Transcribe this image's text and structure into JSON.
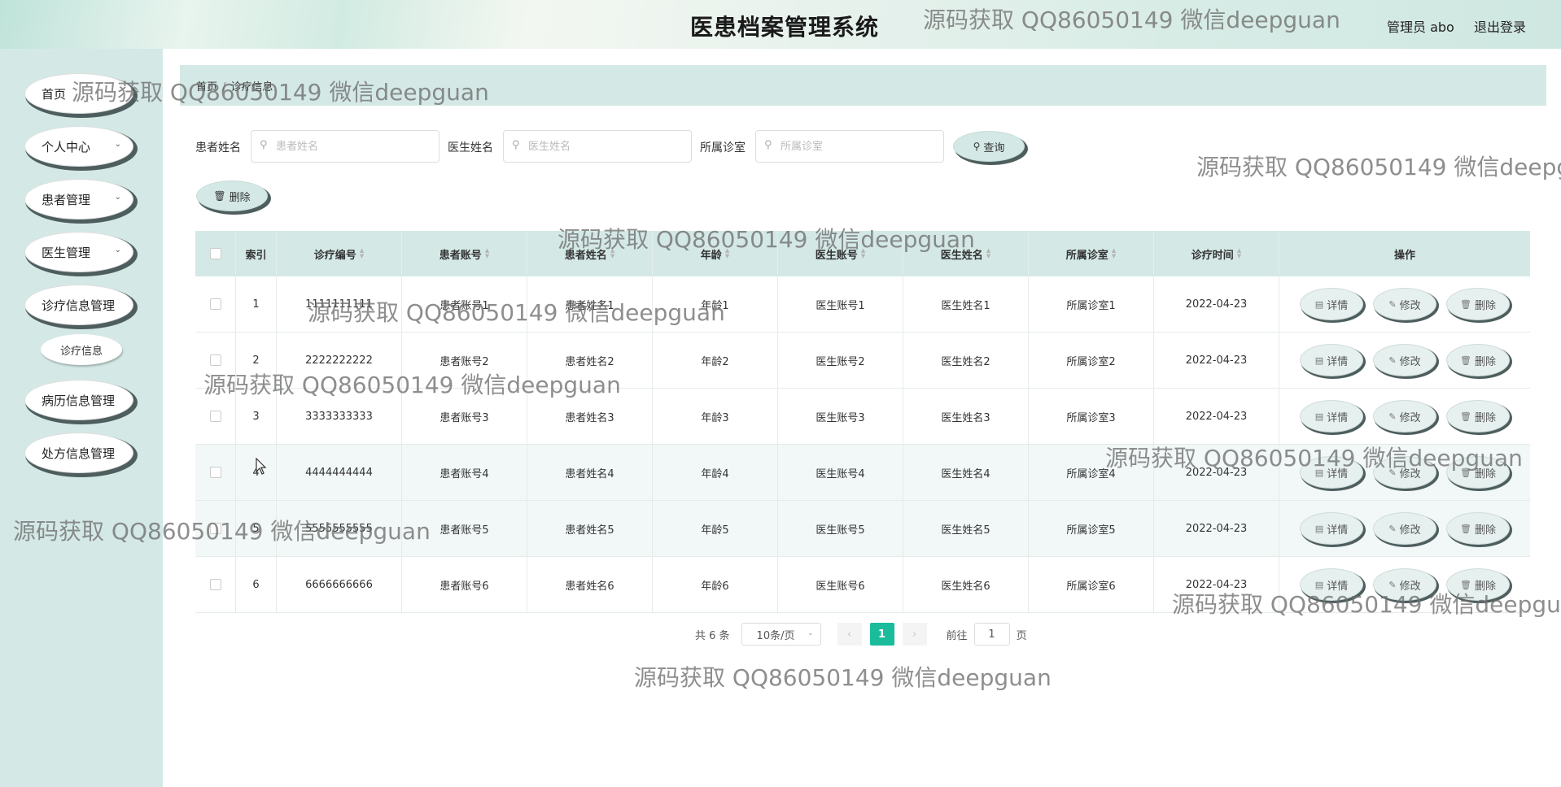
{
  "header": {
    "title": "医患档案管理系统",
    "user": "管理员 abo",
    "logout": "退出登录"
  },
  "sidebar": {
    "items": [
      {
        "label": "首页",
        "has_children": false
      },
      {
        "label": "个人中心",
        "has_children": true
      },
      {
        "label": "患者管理",
        "has_children": true
      },
      {
        "label": "医生管理",
        "has_children": true
      },
      {
        "label": "诊疗信息管理",
        "has_children": false
      },
      {
        "label": "病历信息管理",
        "has_children": false
      },
      {
        "label": "处方信息管理",
        "has_children": false
      }
    ],
    "submenu": {
      "label": "诊疗信息"
    }
  },
  "breadcrumb": {
    "home": "首页",
    "separator": "/",
    "current": "诊疗信息"
  },
  "search": {
    "patient_name_label": "患者姓名",
    "patient_name_placeholder": "患者姓名",
    "doctor_name_label": "医生姓名",
    "doctor_name_placeholder": "医生姓名",
    "clinic_label": "所属诊室",
    "clinic_placeholder": "所属诊室",
    "query_label": "查询",
    "delete_label": "删除"
  },
  "table": {
    "columns": [
      "索引",
      "诊疗编号",
      "患者账号",
      "患者姓名",
      "年龄",
      "医生账号",
      "医生姓名",
      "所属诊室",
      "诊疗时间",
      "操作"
    ],
    "rows": [
      [
        "1",
        "1111111111",
        "患者账号1",
        "患者姓名1",
        "年龄1",
        "医生账号1",
        "医生姓名1",
        "所属诊室1",
        "2022-04-23"
      ],
      [
        "2",
        "2222222222",
        "患者账号2",
        "患者姓名2",
        "年龄2",
        "医生账号2",
        "医生姓名2",
        "所属诊室2",
        "2022-04-23"
      ],
      [
        "3",
        "3333333333",
        "患者账号3",
        "患者姓名3",
        "年龄3",
        "医生账号3",
        "医生姓名3",
        "所属诊室3",
        "2022-04-23"
      ],
      [
        "4",
        "4444444444",
        "患者账号4",
        "患者姓名4",
        "年龄4",
        "医生账号4",
        "医生姓名4",
        "所属诊室4",
        "2022-04-23"
      ],
      [
        "5",
        "5555555555",
        "患者账号5",
        "患者姓名5",
        "年龄5",
        "医生账号5",
        "医生姓名5",
        "所属诊室5",
        "2022-04-23"
      ],
      [
        "6",
        "6666666666",
        "患者账号6",
        "患者姓名6",
        "年龄6",
        "医生账号6",
        "医生姓名6",
        "所属诊室6",
        "2022-04-23"
      ]
    ],
    "actions": {
      "detail": "详情",
      "edit": "修改",
      "delete": "删除"
    }
  },
  "pagination": {
    "total": "共 6 条",
    "page_size": "10条/页",
    "current_page": "1",
    "goto_label": "前往",
    "goto_value": "1",
    "page_unit": "页"
  },
  "watermark": "源码获取 QQ86050149 微信deepguan",
  "colors": {
    "accent": "#1abc9c",
    "panel": "#d4e9e6",
    "pill_shadow": "#4e5e5e"
  }
}
